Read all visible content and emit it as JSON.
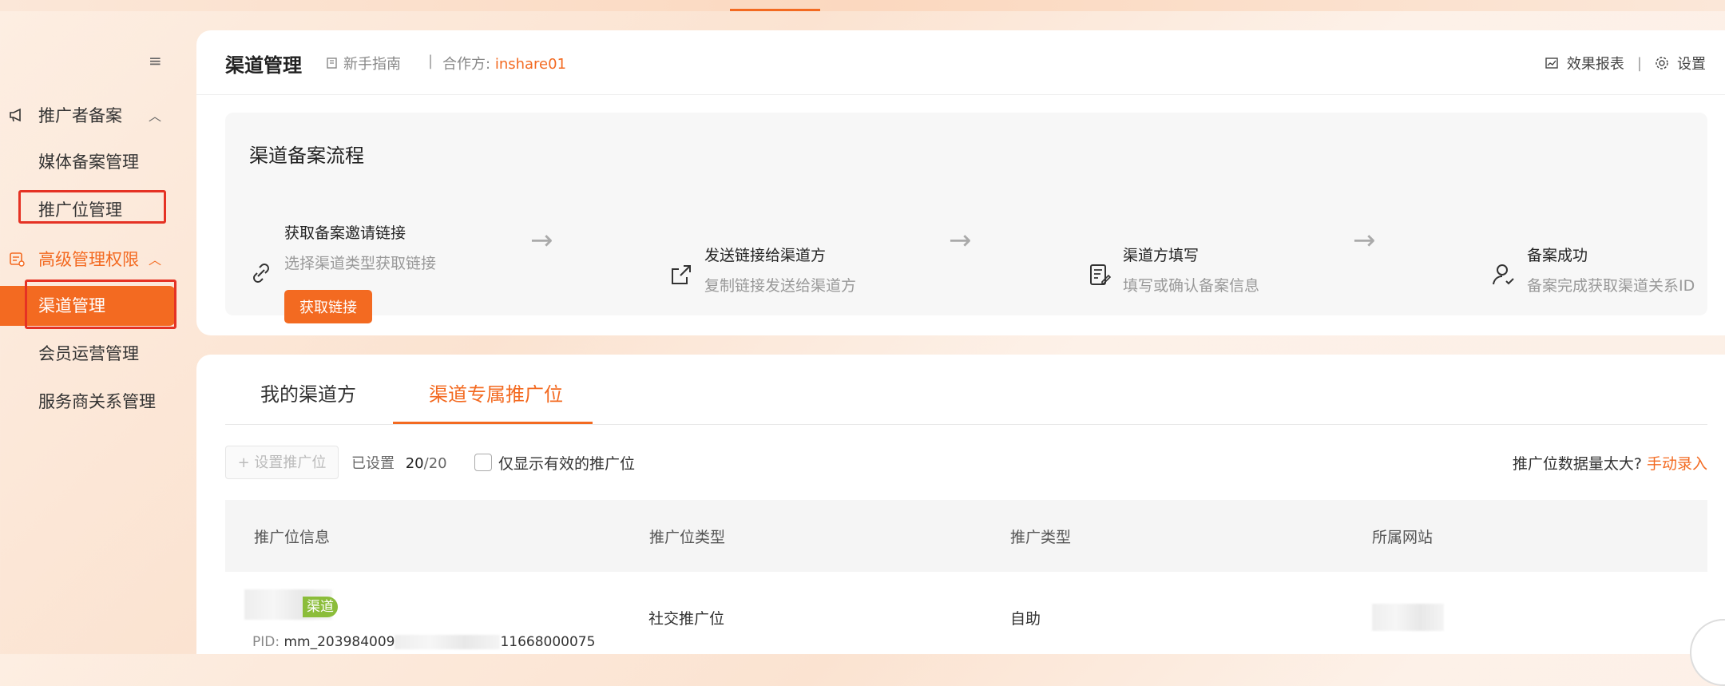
{
  "sidebar": {
    "group1": {
      "label": "推广者备案",
      "chevron": "︿"
    },
    "item_media": "媒体备案管理",
    "item_position": "推广位管理",
    "group2": {
      "label": "高级管理权限",
      "chevron": "︿"
    },
    "item_channel": "渠道管理",
    "item_member": "会员运营管理",
    "item_provider": "服务商关系管理",
    "collapse_icon": "≡"
  },
  "header": {
    "title": "渠道管理",
    "guide": "新手指南",
    "sep": "|",
    "partner_label": "合作方:",
    "partner_value": "inshare01",
    "report": "效果报表",
    "right_sep": "|",
    "settings": "设置"
  },
  "flow": {
    "title": "渠道备案流程",
    "steps": [
      {
        "title": "获取备案邀请链接",
        "desc": "选择渠道类型获取链接",
        "icon": "link-icon"
      },
      {
        "title": "发送链接给渠道方",
        "desc": "复制链接发送给渠道方",
        "icon": "share-icon"
      },
      {
        "title": "渠道方填写",
        "desc": "填写或确认备案信息",
        "icon": "form-icon"
      },
      {
        "title": "备案成功",
        "desc": "备案完成获取渠道关系ID",
        "icon": "user-check-icon"
      }
    ],
    "arrow": "→",
    "button": "获取链接"
  },
  "tabs": {
    "tab1": "我的渠道方",
    "tab2": "渠道专属推广位"
  },
  "toolbar": {
    "set_button": "+ 设置推广位",
    "set_label": "已设置",
    "set_count": "20",
    "set_total": "/20",
    "checkbox_label": "仅显示有效的推广位",
    "tip_text": "推广位数据量太大?",
    "tip_link": "手动录入"
  },
  "table": {
    "headers": [
      "推广位信息",
      "推广位类型",
      "推广类型",
      "所属网站"
    ],
    "rows": [
      {
        "badge": "渠道",
        "pid_label": "PID:",
        "pid_start": "mm_203984009",
        "pid_end": "11668000075",
        "type": "社交推广位",
        "promo_type": "自助"
      }
    ]
  },
  "colors": {
    "accent": "#f36a21",
    "badge": "#8bbd3a",
    "highlight_box": "#e53224"
  }
}
